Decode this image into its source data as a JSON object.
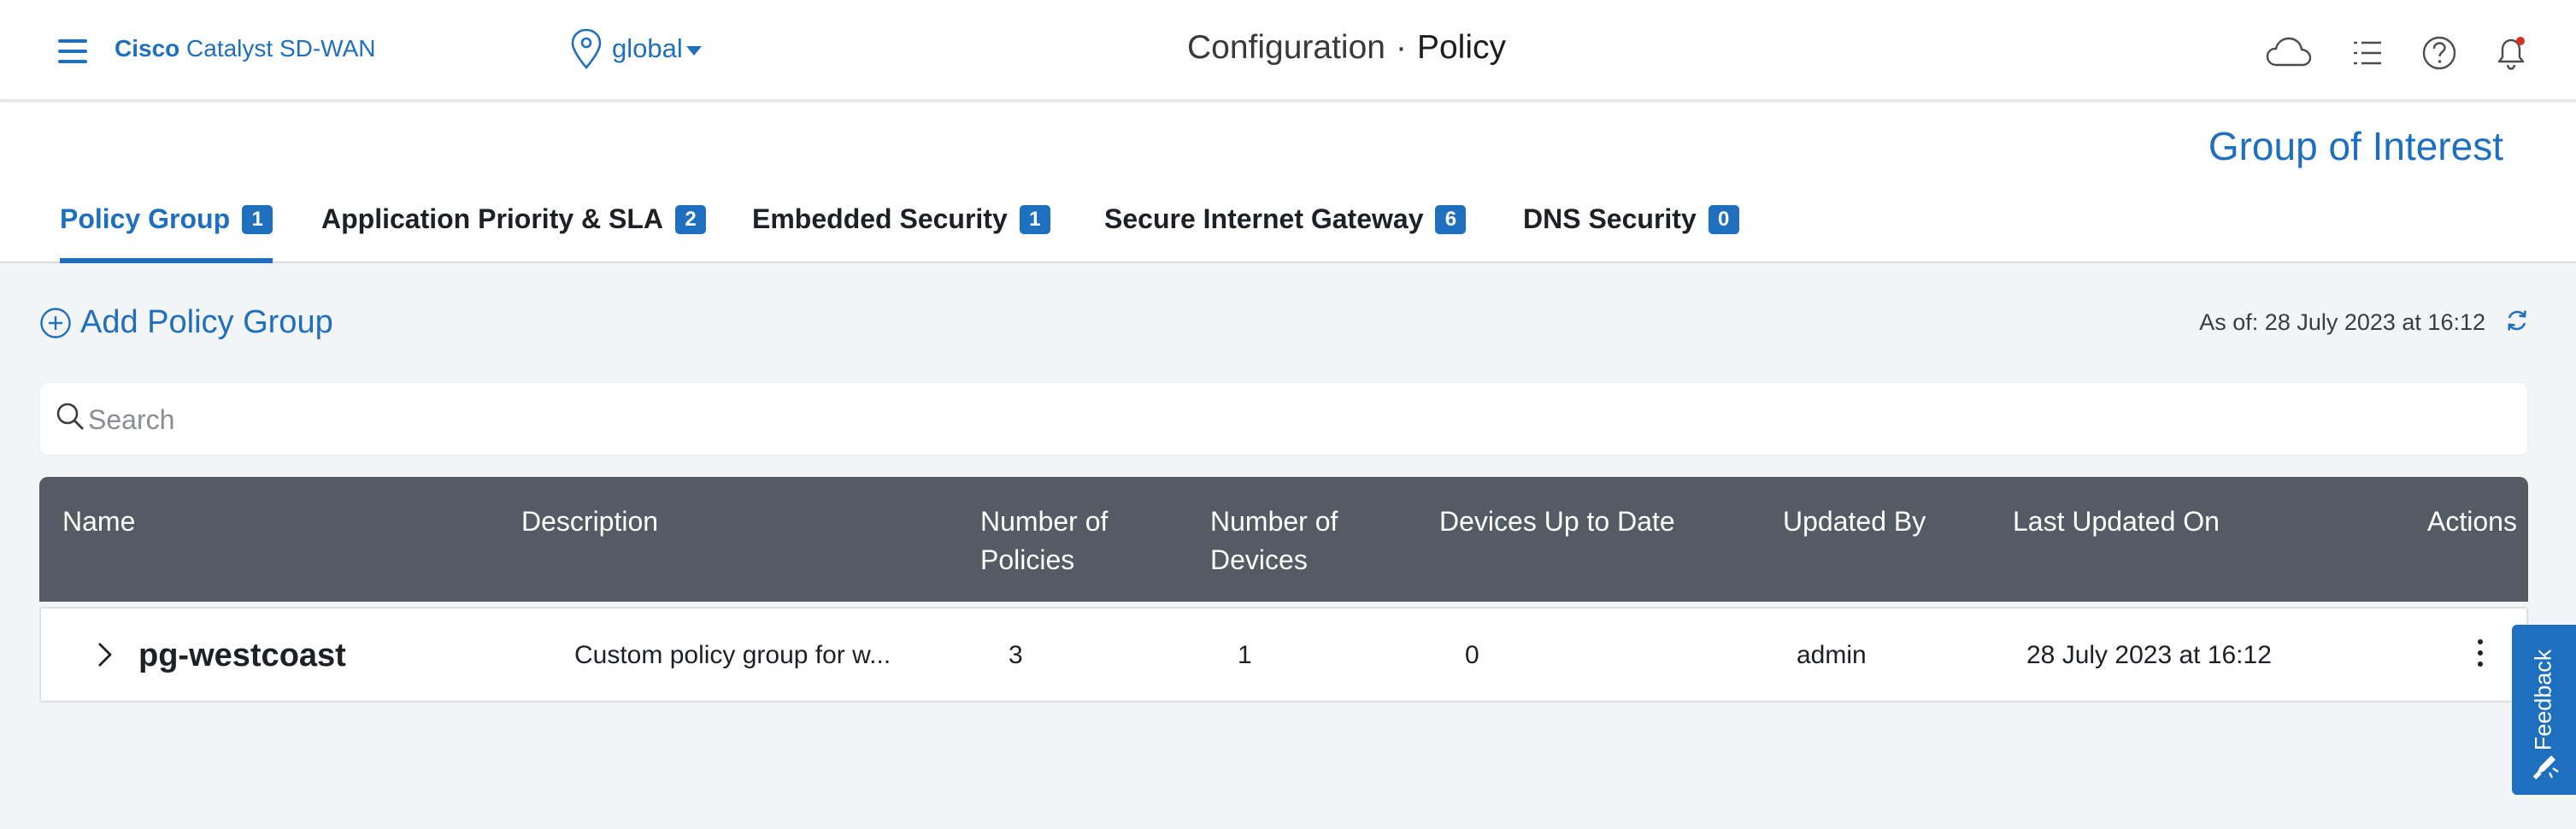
{
  "header": {
    "brand_bold": "Cisco",
    "brand_rest": " Catalyst SD-WAN",
    "location": "global",
    "title_section": "Configuration",
    "title_separator": "·",
    "title_page": "Policy"
  },
  "group_of_interest": "Group of Interest",
  "tabs": [
    {
      "label": "Policy Group",
      "count": "1"
    },
    {
      "label": "Application Priority & SLA",
      "count": "2"
    },
    {
      "label": "Embedded Security",
      "count": "1"
    },
    {
      "label": "Secure Internet Gateway",
      "count": "6"
    },
    {
      "label": "DNS Security",
      "count": "0"
    }
  ],
  "toolbar": {
    "add_label": "Add Policy Group",
    "as_of": "As of: 28 July 2023 at 16:12"
  },
  "search": {
    "placeholder": "Search",
    "value": ""
  },
  "table": {
    "columns": {
      "name": "Name",
      "description": "Description",
      "policies_line1": "Number of",
      "policies_line2": "Policies",
      "devices_line1": "Number of",
      "devices_line2": "Devices",
      "up_to_date": "Devices Up to Date",
      "updated_by": "Updated By",
      "last_updated": "Last Updated On",
      "actions": "Actions"
    },
    "rows": [
      {
        "name": "pg-westcoast",
        "description": "Custom policy group for w...",
        "policies": "3",
        "devices": "1",
        "up_to_date": "0",
        "updated_by": "admin",
        "last_updated": "28 July 2023 at 16:12"
      }
    ]
  },
  "feedback_label": "Feedback",
  "colors": {
    "accent": "#1f6fbf",
    "table_header": "#545b64",
    "notification_dot": "#d93025"
  }
}
